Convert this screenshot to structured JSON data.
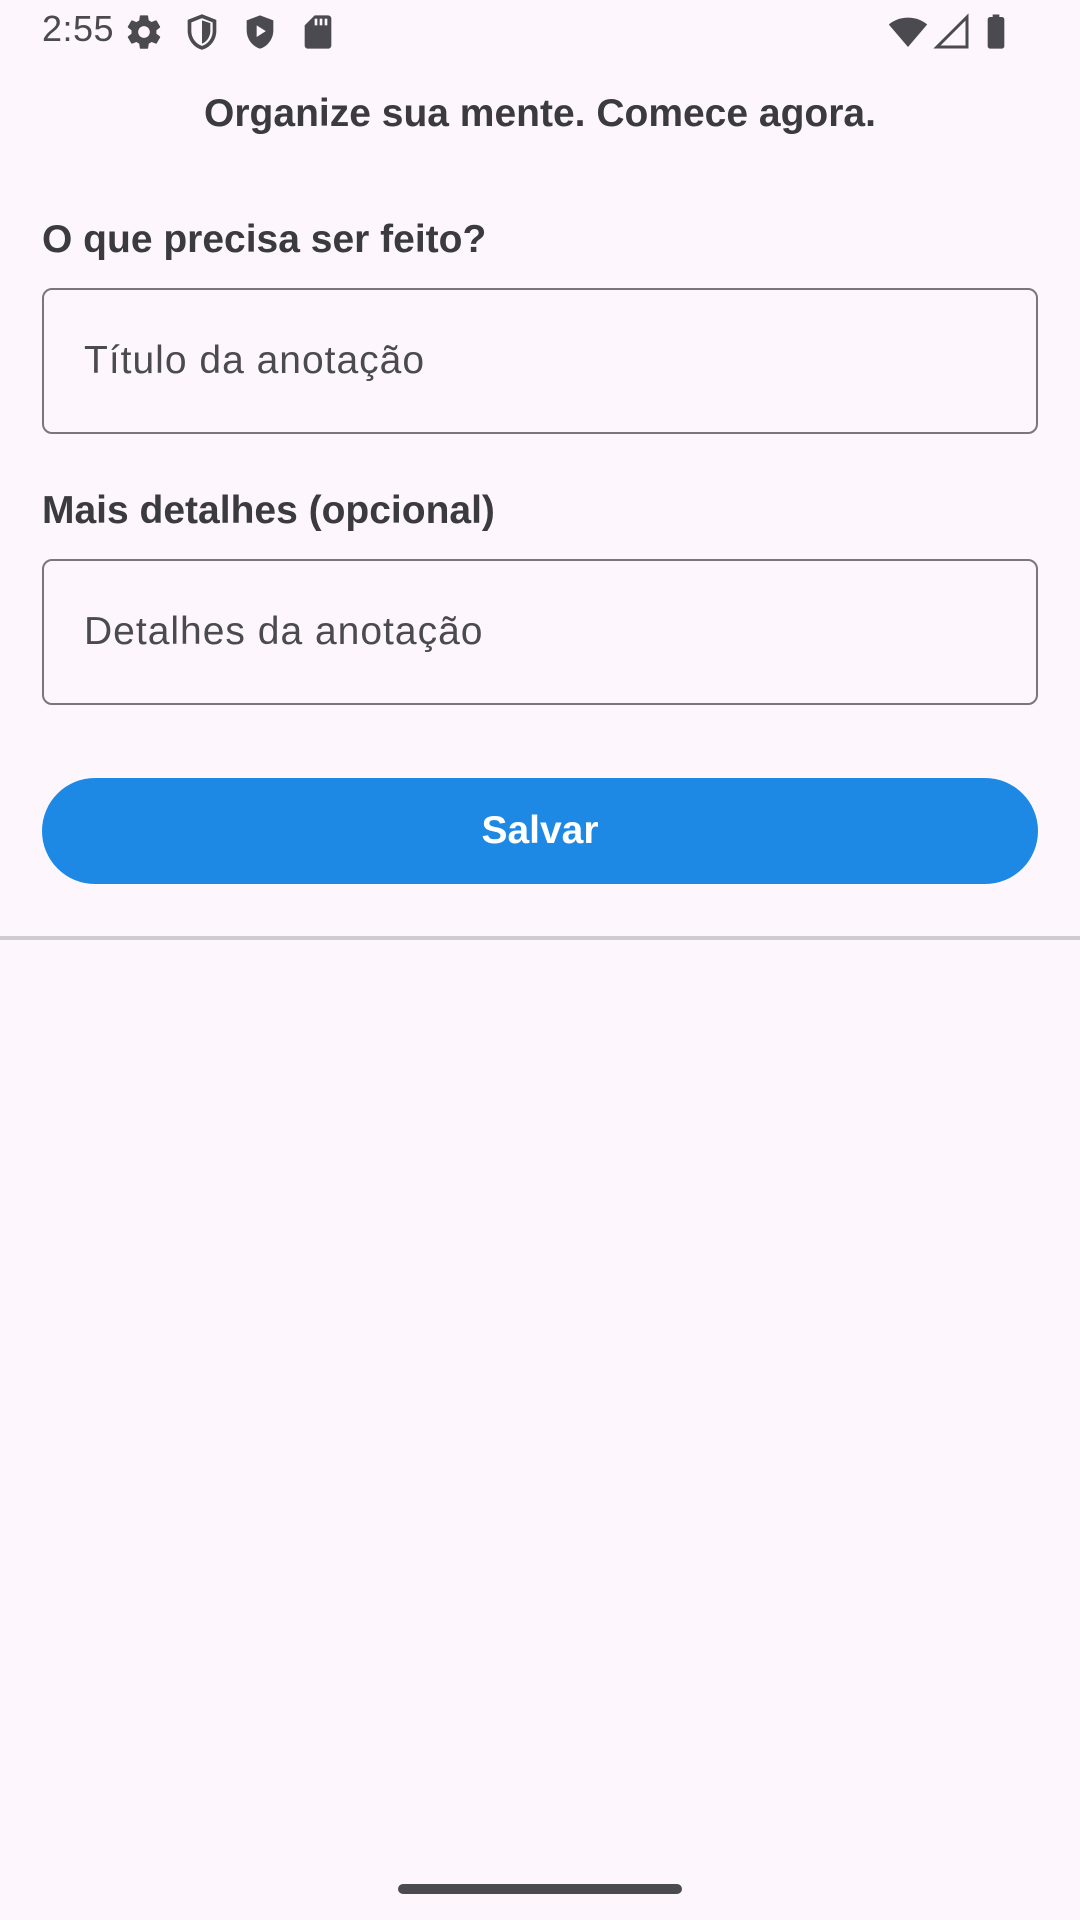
{
  "status_bar": {
    "time": "2:55",
    "left_icons": [
      "settings-icon",
      "shield-icon",
      "play-protect-icon",
      "sd-card-icon"
    ],
    "right_icons": [
      "wifi-icon",
      "cellular-signal-icon",
      "battery-icon"
    ]
  },
  "header": {
    "title": "Organize sua mente. Comece agora."
  },
  "form": {
    "title_label": "O que precisa ser feito?",
    "title_placeholder": "Título da anotação",
    "title_value": "",
    "details_label": "Mais detalhes (opcional)",
    "details_placeholder": "Detalhes da anotação",
    "details_value": "",
    "save_label": "Salvar"
  },
  "colors": {
    "background": "#FDF7FD",
    "accent": "#1E88E5",
    "text": "#3A3A40",
    "border": "#7A757F"
  }
}
